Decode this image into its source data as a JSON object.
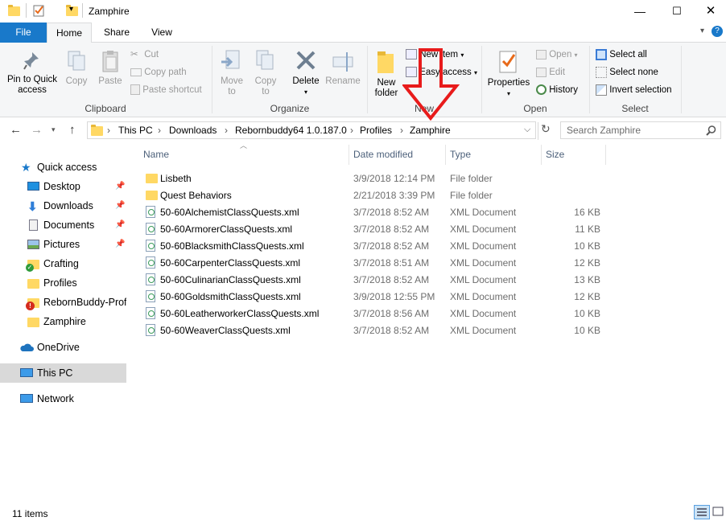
{
  "window": {
    "title": "Zamphire",
    "quick_access_toolbar": [
      "properties-icon",
      "new-folder-icon"
    ]
  },
  "ribbon_tabs": {
    "file": "File",
    "home": "Home",
    "share": "Share",
    "view": "View"
  },
  "ribbon": {
    "clipboard": {
      "label": "Clipboard",
      "pin": "Pin to Quick\naccess",
      "copy": "Copy",
      "paste": "Paste",
      "cut": "Cut",
      "copy_path": "Copy path",
      "paste_shortcut": "Paste shortcut"
    },
    "organize": {
      "label": "Organize",
      "move_to": "Move\nto",
      "copy_to": "Copy\nto",
      "delete": "Delete",
      "rename": "Rename"
    },
    "new": {
      "label": "New",
      "new_folder": "New\nfolder",
      "new_item": "New item",
      "easy_access": "Easy access"
    },
    "open": {
      "label": "Open",
      "properties": "Properties",
      "open": "Open",
      "edit": "Edit",
      "history": "History"
    },
    "select": {
      "label": "Select",
      "select_all": "Select all",
      "select_none": "Select none",
      "invert": "Invert selection"
    }
  },
  "breadcrumb": [
    "This PC",
    "Downloads",
    "Rebornbuddy64 1.0.187.0",
    "Profiles",
    "Zamphire"
  ],
  "search": {
    "placeholder": "Search Zamphire"
  },
  "sidebar": {
    "quick_access": "Quick access",
    "items": [
      {
        "label": "Desktop",
        "pinned": true
      },
      {
        "label": "Downloads",
        "pinned": true
      },
      {
        "label": "Documents",
        "pinned": true
      },
      {
        "label": "Pictures",
        "pinned": true
      },
      {
        "label": "Crafting",
        "pinned": false
      },
      {
        "label": "Profiles",
        "pinned": false
      },
      {
        "label": "RebornBuddy-Profi",
        "pinned": false
      },
      {
        "label": "Zamphire",
        "pinned": false
      }
    ],
    "onedrive": "OneDrive",
    "this_pc": "This PC",
    "network": "Network"
  },
  "columns": {
    "name": "Name",
    "date": "Date modified",
    "type": "Type",
    "size": "Size"
  },
  "files": [
    {
      "name": "Lisbeth",
      "date": "3/9/2018 12:14 PM",
      "type": "File folder",
      "size": "",
      "kind": "folder"
    },
    {
      "name": "Quest Behaviors",
      "date": "2/21/2018 3:39 PM",
      "type": "File folder",
      "size": "",
      "kind": "folder"
    },
    {
      "name": "50-60AlchemistClassQuests.xml",
      "date": "3/7/2018 8:52 AM",
      "type": "XML Document",
      "size": "16 KB",
      "kind": "xml"
    },
    {
      "name": "50-60ArmorerClassQuests.xml",
      "date": "3/7/2018 8:52 AM",
      "type": "XML Document",
      "size": "11 KB",
      "kind": "xml"
    },
    {
      "name": "50-60BlacksmithClassQuests.xml",
      "date": "3/7/2018 8:52 AM",
      "type": "XML Document",
      "size": "10 KB",
      "kind": "xml"
    },
    {
      "name": "50-60CarpenterClassQuests.xml",
      "date": "3/7/2018 8:51 AM",
      "type": "XML Document",
      "size": "12 KB",
      "kind": "xml"
    },
    {
      "name": "50-60CulinarianClassQuests.xml",
      "date": "3/7/2018 8:52 AM",
      "type": "XML Document",
      "size": "13 KB",
      "kind": "xml"
    },
    {
      "name": "50-60GoldsmithClassQuests.xml",
      "date": "3/9/2018 12:55 PM",
      "type": "XML Document",
      "size": "12 KB",
      "kind": "xml"
    },
    {
      "name": "50-60LeatherworkerClassQuests.xml",
      "date": "3/7/2018 8:56 AM",
      "type": "XML Document",
      "size": "10 KB",
      "kind": "xml"
    },
    {
      "name": "50-60WeaverClassQuests.xml",
      "date": "3/7/2018 8:52 AM",
      "type": "XML Document",
      "size": "10 KB",
      "kind": "xml"
    }
  ],
  "status": {
    "count": "11 items"
  },
  "colors": {
    "accent": "#1979ca",
    "arrow": "#e81b1b",
    "folder": "#ffd864",
    "selected_nav": "#d9d9d9"
  }
}
